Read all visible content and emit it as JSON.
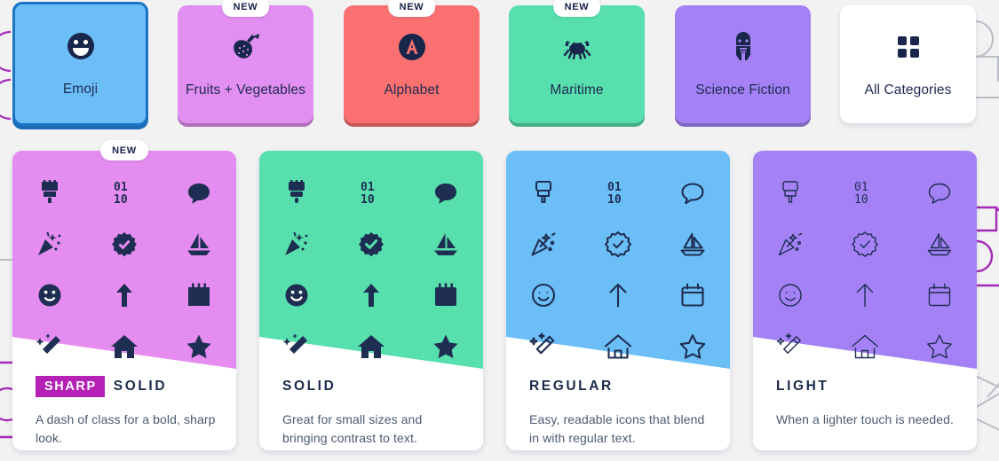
{
  "categories": {
    "section_name": "icon-categories",
    "items": [
      {
        "label": "Emoji",
        "icon": "grin-emoji-icon",
        "color": "#6cbef7",
        "selected": true,
        "badge": null,
        "text_color": "#19264c"
      },
      {
        "label": "Fruits + Vegetables",
        "icon": "strawberry-icon",
        "color": "#e18ff0",
        "selected": false,
        "badge": "NEW",
        "text_color": "#19264c"
      },
      {
        "label": "Alphabet",
        "icon": "letter-a-circle-icon",
        "color": "#fb7171",
        "selected": false,
        "badge": "NEW",
        "text_color": "#19264c"
      },
      {
        "label": "Maritime",
        "icon": "crab-icon",
        "color": "#57dfad",
        "selected": false,
        "badge": "NEW",
        "text_color": "#19264c"
      },
      {
        "label": "Science Fiction",
        "icon": "robot-icon",
        "color": "#a482f5",
        "selected": false,
        "badge": null,
        "text_color": "#19264c"
      },
      {
        "label": "All Categories",
        "icon": "grid-squares-icon",
        "color": "#ffffff",
        "selected": false,
        "badge": null,
        "text_color": "#19264c"
      }
    ]
  },
  "styles": {
    "section_name": "icon-style-cards",
    "icon_color": "#1e2e52",
    "grid_icons": [
      "paintbrush-icon",
      "binary-icon",
      "speech-bubble-icon",
      "party-popper-icon",
      "badge-check-icon",
      "sailboat-icon",
      "smiley-face-icon",
      "arrow-up-icon",
      "calendar-icon",
      "magic-wand-icon",
      "house-icon",
      "star-icon"
    ],
    "cards": [
      {
        "prefix": "SHARP",
        "title": "SOLID",
        "description": "A dash of class for a bold, sharp look.",
        "color": "#e58cf0",
        "badge": "NEW",
        "weight": "solid",
        "sharp": true,
        "prefix_bg": "#b520b5"
      },
      {
        "prefix": null,
        "title": "SOLID",
        "description": "Great for small sizes and bringing contrast to text.",
        "color": "#57dfad",
        "badge": null,
        "weight": "solid",
        "sharp": false,
        "prefix_bg": null
      },
      {
        "prefix": null,
        "title": "REGULAR",
        "description": "Easy, readable icons that blend in with regular text.",
        "color": "#6cbef7",
        "badge": null,
        "weight": "regular",
        "sharp": false,
        "prefix_bg": null
      },
      {
        "prefix": null,
        "title": "LIGHT",
        "description": "When a lighter touch is needed.",
        "color": "#a482f5",
        "badge": null,
        "weight": "light",
        "sharp": false,
        "prefix_bg": null
      }
    ]
  },
  "theme": {
    "background": "#f2f2f3",
    "selected_border": "#1b74c4",
    "dark_text": "#1b2b4b",
    "body_text": "#4b5a72",
    "deco_gray": "#b9bdc4",
    "deco_purple": "#a32bb8"
  }
}
